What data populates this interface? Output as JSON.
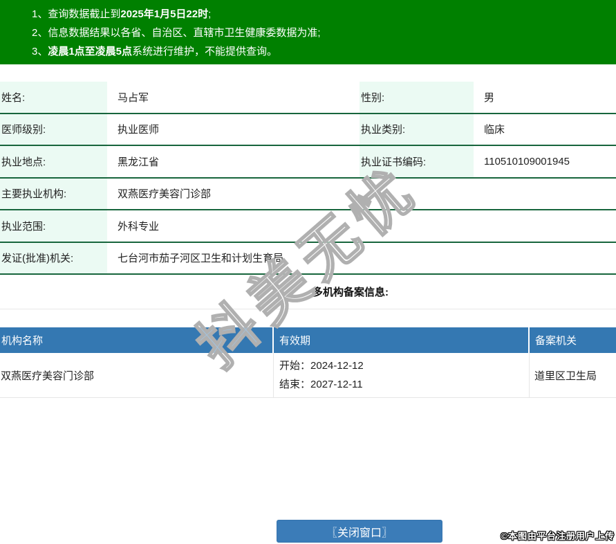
{
  "notices": [
    {
      "num": "1、",
      "pre": "查询数据截止到",
      "bold": "2025年1月5日22时",
      "post": ";"
    },
    {
      "num": "2、",
      "pre": "信息数据结果以各省、自治区、直辖市卫生健康委数据为准;",
      "bold": "",
      "post": ""
    },
    {
      "num": "3、",
      "pre": "",
      "bold": "凌晨1点至凌晨5点",
      "post": "系统进行维护，不能提供查询。"
    }
  ],
  "info": {
    "rows2col": [
      {
        "label1": "姓名:",
        "value1": "马占军",
        "label2": "性别:",
        "value2": "男"
      },
      {
        "label1": "医师级别:",
        "value1": "执业医师",
        "label2": "执业类别:",
        "value2": "临床"
      },
      {
        "label1": "执业地点:",
        "value1": "黑龙江省",
        "label2": "执业证书编码:",
        "value2": "110510109001945"
      }
    ],
    "rows1col": [
      {
        "label": "主要执业机构:",
        "value": "双燕医疗美容门诊部"
      },
      {
        "label": "执业范围:",
        "value": "外科专业"
      },
      {
        "label": "发证(批准)机关:",
        "value": "七台河市茄子河区卫生和计划生育局"
      }
    ]
  },
  "filing": {
    "section_title": "多机构备案信息:",
    "headers": [
      "机构名称",
      "有效期",
      "备案机关"
    ],
    "row": {
      "org": "双燕医疗美容门诊部",
      "start_label": "开始：",
      "start_date": "2024-12-12",
      "end_label": "结束：",
      "end_date": "2027-12-11",
      "authority": "道里区卫生局"
    }
  },
  "watermark_text": "抖美无忧",
  "footer": {
    "close_button": "〖关闭窗口〗",
    "copyright": "©本图由平台注册用户上传"
  },
  "colors": {
    "banner_green": "#008000",
    "label_mint": "#ebfaf3",
    "divider_green": "#17653c",
    "header_blue": "#3478b2",
    "button_blue": "#3b7cb8"
  }
}
